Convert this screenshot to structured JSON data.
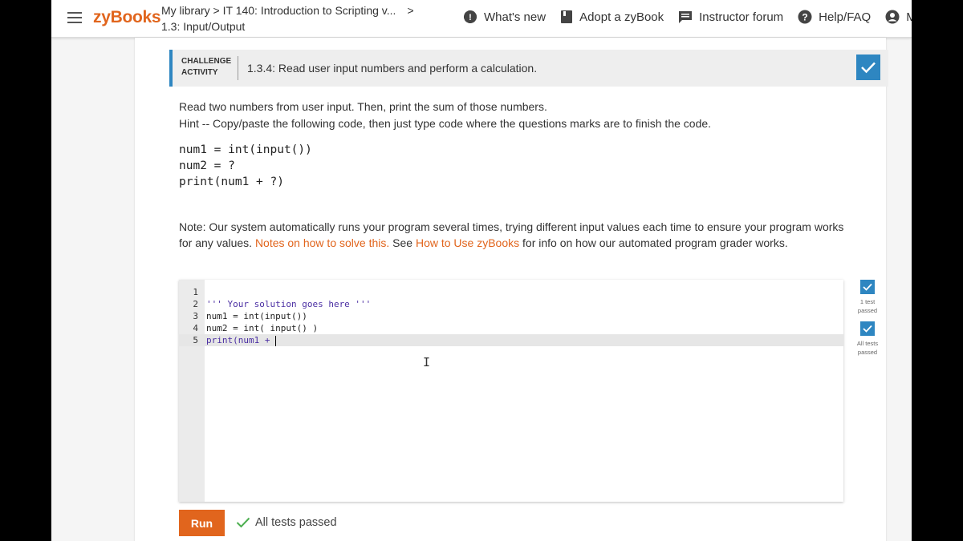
{
  "header": {
    "logo": "zyBooks",
    "breadcrumb_line1": "My library > IT 140: Introduction to Scripting v...",
    "breadcrumb_chevron": ">",
    "breadcrumb_line2": "1.3: Input/Output",
    "nav": [
      {
        "label": "What's new",
        "icon": "gear-badge-icon"
      },
      {
        "label": "Adopt a zyBook",
        "icon": "book-icon"
      },
      {
        "label": "Instructor forum",
        "icon": "chat-icon"
      },
      {
        "label": "Help/FAQ",
        "icon": "help-icon"
      },
      {
        "label": "M",
        "icon": "account-icon"
      }
    ]
  },
  "challenge": {
    "type_label": "CHALLENGE ACTIVITY",
    "title": "1.3.4: Read user input numbers and perform a calculation.",
    "completed": true
  },
  "instructions": {
    "line1": "Read two numbers from user input. Then, print the sum of those numbers.",
    "line2": "Hint -- Copy/paste the following code, then just type code where the questions marks are to finish the code."
  },
  "code_hint": "num1 = int(input())\nnum2 = ?\nprint(num1 + ?)",
  "note": {
    "prefix": "Note: Our system automatically runs your program several times, trying different input values each time to ensure your program works for any values. ",
    "link1": "Notes on how to solve this.",
    "middle": " See ",
    "link2": "How to Use zyBooks",
    "suffix": " for info on how our automated program grader works."
  },
  "editor": {
    "lines": [
      {
        "n": "1",
        "text": ""
      },
      {
        "n": "2",
        "text": "''' Your solution goes here '''"
      },
      {
        "n": "3",
        "text": "num1 = int(input())"
      },
      {
        "n": "4",
        "text": "num2 = int( input() )"
      },
      {
        "n": "5",
        "text": "print(num1 + "
      }
    ]
  },
  "tests": [
    {
      "label": "1 test passed"
    },
    {
      "label": "All tests passed"
    }
  ],
  "run": {
    "label": "Run",
    "result": "All tests passed"
  },
  "colors": {
    "brand": "#e1651d",
    "accent": "#2e86c1",
    "success": "#4caf50"
  }
}
